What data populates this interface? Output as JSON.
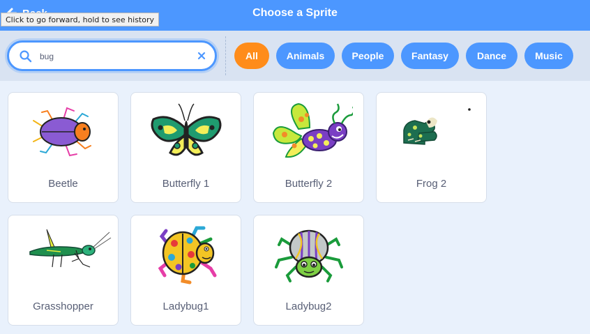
{
  "header": {
    "back_label": "Back",
    "title": "Choose a Sprite",
    "tooltip": "Click to go forward, hold to see history"
  },
  "search": {
    "value": "bug",
    "placeholder": "Search"
  },
  "tags": [
    {
      "label": "All",
      "active": true
    },
    {
      "label": "Animals",
      "active": false
    },
    {
      "label": "People",
      "active": false
    },
    {
      "label": "Fantasy",
      "active": false
    },
    {
      "label": "Dance",
      "active": false
    },
    {
      "label": "Music",
      "active": false
    }
  ],
  "sprites": [
    {
      "name": "Beetle",
      "icon": "beetle-icon"
    },
    {
      "name": "Butterfly 1",
      "icon": "butterfly-icon"
    },
    {
      "name": "Butterfly 2",
      "icon": "butterfly-2-icon"
    },
    {
      "name": "Frog 2",
      "icon": "frog-icon"
    },
    {
      "name": "Grasshopper",
      "icon": "grasshopper-icon"
    },
    {
      "name": "Ladybug1",
      "icon": "ladybug-icon"
    },
    {
      "name": "Ladybug2",
      "icon": "ladybug-2-icon"
    }
  ],
  "colors": {
    "header": "#4c97ff",
    "active_tag": "#ff8c1a",
    "background": "#e9f1fc"
  }
}
